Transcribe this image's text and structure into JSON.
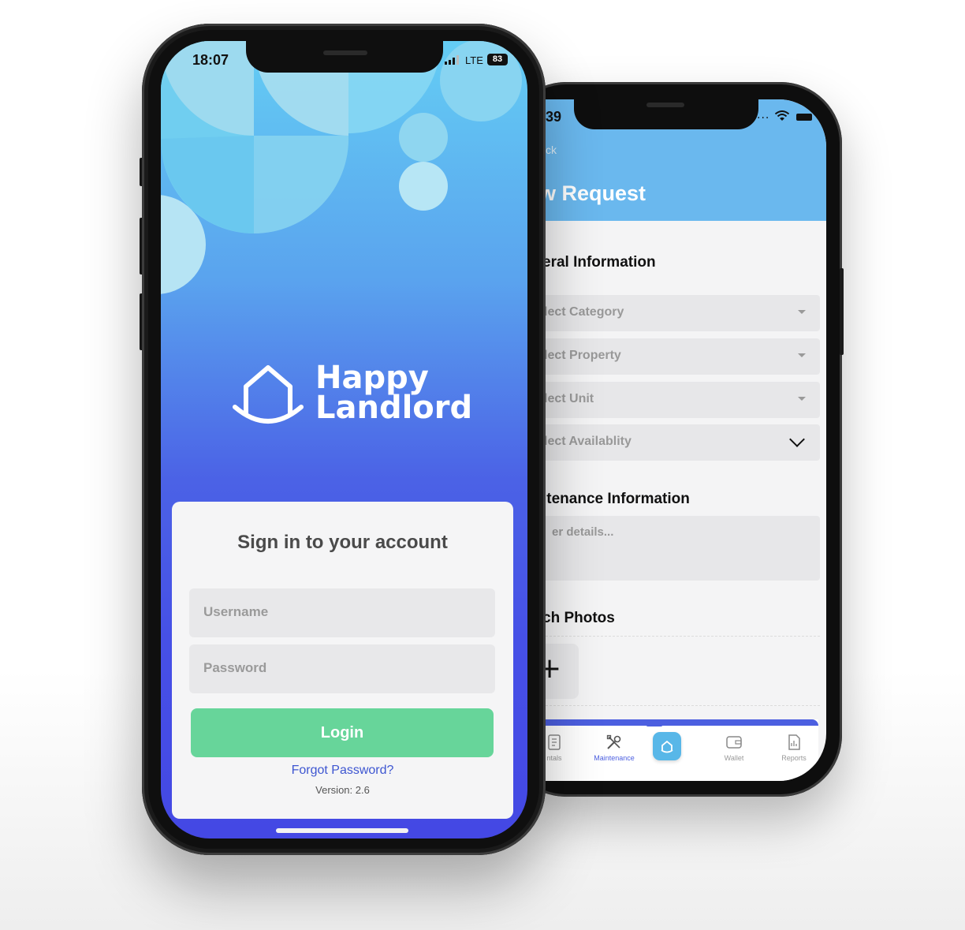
{
  "back_screen": {
    "status": {
      "time": "39",
      "signal": "...",
      "wifi": "wifi-icon",
      "battery": "battery-icon"
    },
    "header": {
      "back_label": "ck",
      "title": "w Request"
    },
    "sections": {
      "general": "eral Information",
      "maintenance": "itenance Information",
      "photos": "ch Photos"
    },
    "dropdowns": [
      {
        "label": "lect Category",
        "icon": "caret-down-icon"
      },
      {
        "label": "lect Property",
        "icon": "caret-down-icon"
      },
      {
        "label": "lect Unit",
        "icon": "caret-down-icon"
      },
      {
        "label": "lect Availablity",
        "icon": "chevron-down-icon"
      }
    ],
    "details_placeholder": "er details...",
    "add_photo_label": "+",
    "tabs": [
      {
        "label": "ntals",
        "icon": "rentals-icon"
      },
      {
        "label": "Maintenance",
        "icon": "tools-icon",
        "active": true
      },
      {
        "label": "",
        "icon": "home-icon"
      },
      {
        "label": "Wallet",
        "icon": "wallet-icon"
      },
      {
        "label": "Reports",
        "icon": "reports-icon"
      }
    ],
    "colors": {
      "header": "#6ab8ee",
      "accent": "#4c5fe0",
      "home_button": "#58b7e8"
    }
  },
  "front_screen": {
    "status": {
      "time": "18:07",
      "carrier": "LTE",
      "battery": "83"
    },
    "brand": {
      "line1": "Happy",
      "line2": "Landlord",
      "icon": "house-smile-logo"
    },
    "login": {
      "title": "Sign in to your account",
      "username_placeholder": "Username",
      "password_placeholder": "Password",
      "login_label": "Login",
      "forgot_label": "Forgot Password?",
      "version": "Version: 2.6"
    },
    "colors": {
      "gradient_top": "#64cdf4",
      "gradient_bottom": "#4448e4",
      "login_button": "#67d59a",
      "link": "#3e56d1"
    }
  }
}
